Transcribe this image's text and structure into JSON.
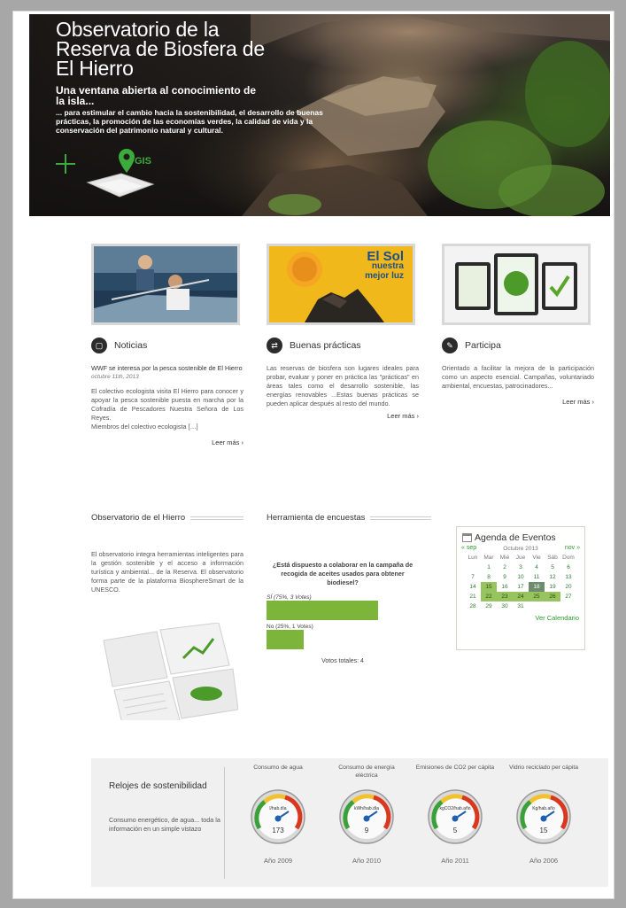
{
  "hero": {
    "title": "Observatorio de la Reserva de Biosfera de El Hierro",
    "subtitle": "Una ventana abierta al conocimiento de la isla...",
    "description": "... para estimular el cambio hacia la sostenibilidad, el desarrollo de buenas prácticas, la promoción de las economías verdes, la calidad de vida y la conservación del patrimonio natural y cultural.",
    "gis_label": "GIS"
  },
  "features": {
    "noticias": {
      "title": "Noticias",
      "news_title": "WWF se interesa por la pesca sostenible de El Hierro",
      "news_date": "octubre 11th, 2013",
      "body": "El colectivo ecologista visita El Hierro para conocer y apoyar la pesca sostenible puesta en marcha por la Cofradía de Pescadores Nuestra Señora de Los Reyes.",
      "body2": "Miembros del colectivo ecologista […]",
      "more": "Leer más ›"
    },
    "buenas": {
      "title": "Buenas prácticas",
      "banner_title": "El Sol",
      "banner_sub1": "nuestra",
      "banner_sub2": "mejor luz",
      "body": "Las reservas de biosfera son lugares ideales para probar, evaluar y poner en práctica las \"prácticas\" en áreas tales como el desarrollo sostenible, las energías renovables ...Estas buenas prácticas se pueden aplicar después al resto del mundo.",
      "more": "Leer más ›"
    },
    "participa": {
      "title": "Participa",
      "body": "Orientado a facilitar la mejora de la participación como un aspecto esencial. Campañas, voluntariado ambiental, encuestas, patrocinadores...",
      "more": "Leer más ›"
    }
  },
  "observatorio": {
    "title": "Observatorio de el Hierro",
    "body": "El observatorio integra herramientas inteligentes para la gestión sostenible y el acceso a información turística y ambiental... de la Reserva. El observatorio forma parte de la plataforma BiosphereSmart de la UNESCO."
  },
  "poll": {
    "title": "Herramienta de encuestas",
    "question": "¿Está dispuesto a colaborar en la campaña de recogida de aceites usados para obtener biodiesel?",
    "options": [
      {
        "label": "SÍ (75%, 3 Votes)",
        "fraction": 0.75
      },
      {
        "label": "No (25%, 1 Votes)",
        "fraction": 0.25
      }
    ],
    "total": "Votos totales: 4"
  },
  "calendar": {
    "title": "Agenda de Eventos",
    "month": "Octubre 2013",
    "prev": "« sep",
    "next": "nov »",
    "days": [
      "Lun",
      "Mar",
      "Mié",
      "Jue",
      "Vie",
      "Sáb",
      "Dom"
    ],
    "weeks": [
      [
        "",
        "1",
        "2",
        "3",
        "4",
        "5",
        "6"
      ],
      [
        "7",
        "8",
        "9",
        "10",
        "11",
        "12",
        "13"
      ],
      [
        "14",
        "15",
        "16",
        "17",
        "18",
        "19",
        "20"
      ],
      [
        "21",
        "22",
        "23",
        "24",
        "25",
        "26",
        "27"
      ],
      [
        "28",
        "29",
        "30",
        "31",
        "",
        "",
        ""
      ]
    ],
    "event_days": [
      "15",
      "22",
      "23",
      "24",
      "25",
      "26"
    ],
    "today": "18",
    "more": "Ver Calendario"
  },
  "clocks": {
    "title": "Relojes de sostenibilidad",
    "description": "Consumo energético, de agua... toda la información en un simple vistazo",
    "items": [
      {
        "name": "Consumo de agua",
        "unit": "l/hab.día",
        "value": "173",
        "year": "Año 2009"
      },
      {
        "name": "Consumo de energía eléctrica",
        "unit": "kWh/hab.día",
        "value": "9",
        "year": "Año 2010"
      },
      {
        "name": "Emisiones de CO2 per cápita",
        "unit": "kgCO2/hab.año",
        "value": "5",
        "year": "Año 2011"
      },
      {
        "name": "Vidrio reciclado per cápita",
        "unit": "Kg/hab.año",
        "value": "15",
        "year": "Año 2006"
      }
    ]
  },
  "colors": {
    "accent_green": "#3cab3c",
    "bar_green": "#7db43a",
    "banner_yellow": "#f1b81b"
  }
}
